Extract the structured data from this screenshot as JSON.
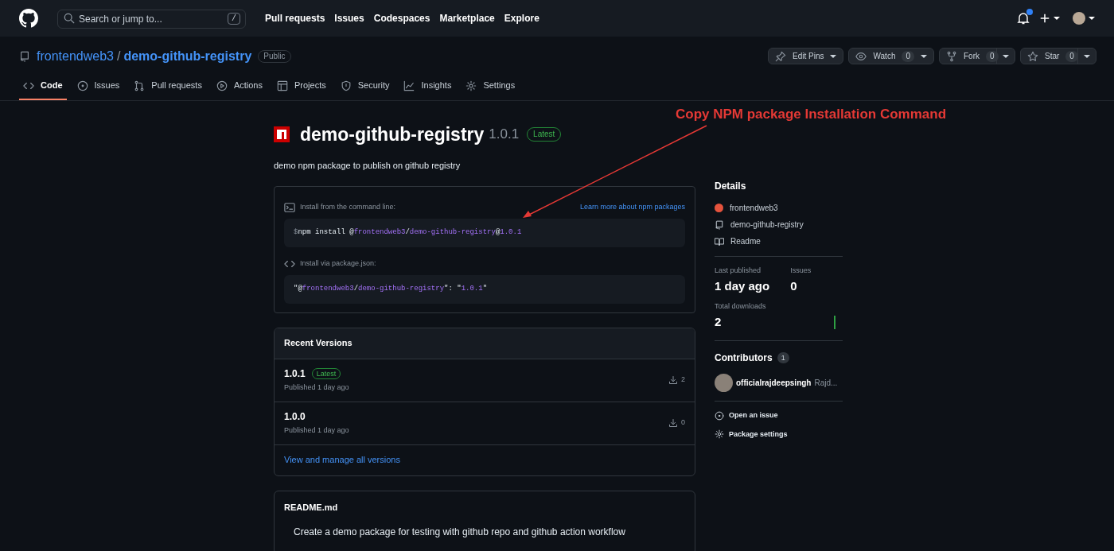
{
  "topbar": {
    "search": {
      "placeholder": "Search or jump to...",
      "shortcut": "/"
    },
    "nav": [
      "Pull requests",
      "Issues",
      "Codespaces",
      "Marketplace",
      "Explore"
    ],
    "notification_unread": true
  },
  "repo": {
    "owner": "frontendweb3",
    "separator": "/",
    "name": "demo-github-registry",
    "visibility": "Public",
    "actions": [
      {
        "label": "Edit Pins",
        "split": false
      },
      {
        "label": "Watch",
        "count": "0",
        "split": false
      },
      {
        "label": "Fork",
        "count": "0",
        "split": true
      },
      {
        "label": "Star",
        "count": "0",
        "split": true
      }
    ],
    "tabs": [
      {
        "label": "Code",
        "selected": true
      },
      {
        "label": "Issues",
        "selected": false
      },
      {
        "label": "Pull requests",
        "selected": false
      },
      {
        "label": "Actions",
        "selected": false
      },
      {
        "label": "Projects",
        "selected": false
      },
      {
        "label": "Security",
        "selected": false
      },
      {
        "label": "Insights",
        "selected": false
      },
      {
        "label": "Settings",
        "selected": false
      }
    ]
  },
  "package": {
    "name": "demo-github-registry",
    "version": "1.0.1",
    "badge": "Latest",
    "description": "demo npm package to publish on github registry",
    "install_cli": {
      "label": "Install from the command line:",
      "link": "Learn more about npm packages",
      "prompt": "$",
      "tokens": [
        {
          "text": "npm install @",
          "accent": false
        },
        {
          "text": "frontendweb3",
          "accent": true
        },
        {
          "text": "/",
          "accent": false
        },
        {
          "text": "demo-github-registry",
          "accent": true
        },
        {
          "text": "@",
          "accent": false
        },
        {
          "text": "1.0.1",
          "accent": true
        }
      ]
    },
    "install_json": {
      "label": "Install via package.json:",
      "tokens": [
        {
          "text": "\"@",
          "accent": false
        },
        {
          "text": "frontendweb3",
          "accent": true
        },
        {
          "text": "/",
          "accent": false
        },
        {
          "text": "demo-github-registry",
          "accent": true
        },
        {
          "text": "\": \"",
          "accent": false
        },
        {
          "text": "1.0.1",
          "accent": true
        },
        {
          "text": "\"",
          "accent": false
        }
      ]
    }
  },
  "recent_versions": {
    "title": "Recent Versions",
    "versions": [
      {
        "version": "1.0.1",
        "badge": "Latest",
        "published": "Published 1 day ago",
        "downloads": "2"
      },
      {
        "version": "1.0.0",
        "published": "Published 1 day ago",
        "downloads": "0"
      }
    ],
    "link": "View and manage all versions"
  },
  "readme": {
    "title": "README.md",
    "body": "Create a demo package for testing with github repo and github action workflow"
  },
  "details": {
    "title": "Details",
    "links": [
      {
        "kind": "owner",
        "label": "frontendweb3"
      },
      {
        "kind": "repo",
        "label": "demo-github-registry"
      },
      {
        "kind": "readme",
        "label": "Readme"
      }
    ],
    "stats": [
      {
        "label": "Last published",
        "value": "1 day ago"
      },
      {
        "label": "Issues",
        "value": "0"
      }
    ],
    "downloads": {
      "label": "Total downloads",
      "value": "2"
    },
    "contributors": {
      "title": "Contributors",
      "count": "1",
      "people": [
        {
          "login": "officialrajdeepsingh",
          "name": "Rajd..."
        }
      ]
    },
    "actions": [
      {
        "kind": "issue",
        "label": "Open an issue"
      },
      {
        "kind": "settings",
        "label": "Package settings"
      }
    ]
  },
  "annotation": {
    "text": "Copy NPM package Installation Command"
  }
}
